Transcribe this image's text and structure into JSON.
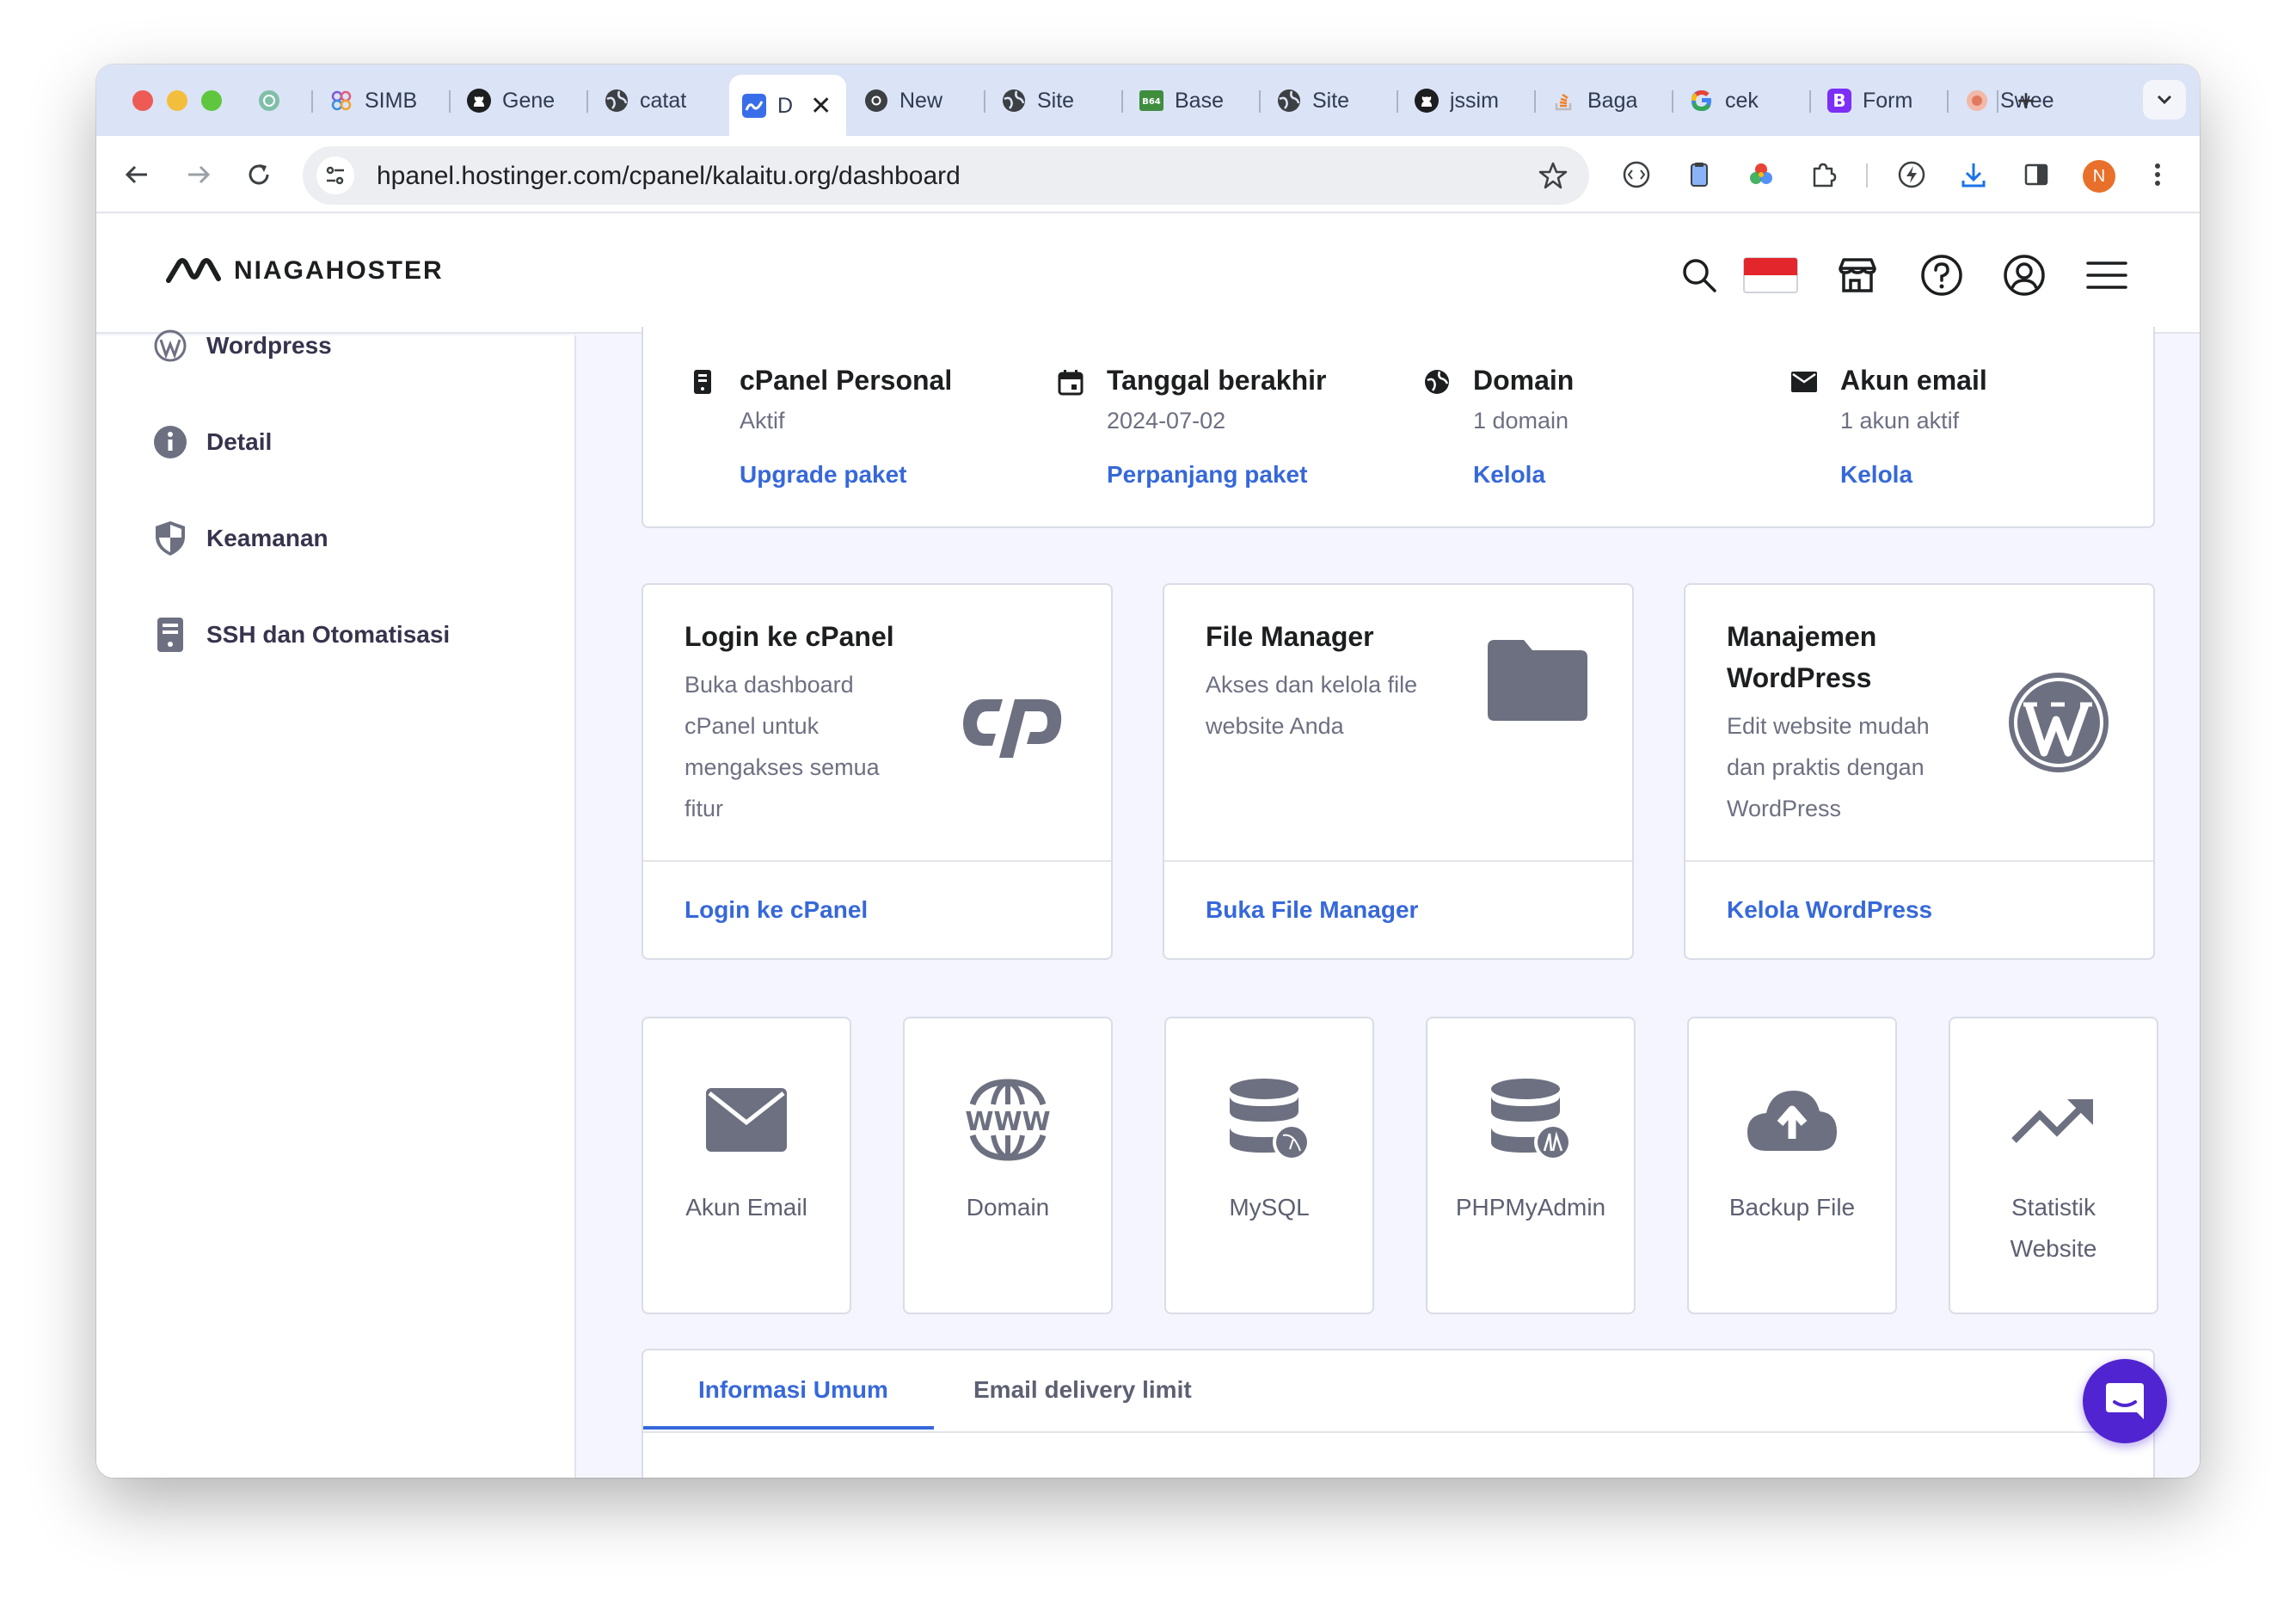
{
  "browser": {
    "tabs": [
      {
        "title": "",
        "icon": "chatgpt-icon"
      },
      {
        "title": "SIMB",
        "icon": "figma-like-icon"
      },
      {
        "title": "Gene",
        "icon": "github-icon"
      },
      {
        "title": "catat",
        "icon": "globe-icon"
      },
      {
        "title": "D",
        "icon": "hostinger-icon",
        "active": true
      },
      {
        "title": "New",
        "icon": "chrome-icon"
      },
      {
        "title": "Site",
        "icon": "globe-icon"
      },
      {
        "title": "Base",
        "icon": "b64-icon"
      },
      {
        "title": "Site",
        "icon": "globe-icon"
      },
      {
        "title": "jssim",
        "icon": "github-icon"
      },
      {
        "title": "Baga",
        "icon": "stackoverflow-icon"
      },
      {
        "title": "cek",
        "icon": "google-icon"
      },
      {
        "title": "Form",
        "icon": "bootstrap-icon"
      },
      {
        "title": "Swee",
        "icon": "sweetalert-icon"
      }
    ],
    "url_host": "hpanel.hostinger.com",
    "url_path": "/cpanel/kalaitu.org/dashboard",
    "profile_initial": "N"
  },
  "header": {
    "logo_text": "NIAGAHOSTER"
  },
  "sidebar": {
    "items": [
      {
        "label": "Wordpress",
        "icon": "wordpress-icon"
      },
      {
        "label": "Detail",
        "icon": "info-icon"
      },
      {
        "label": "Keamanan",
        "icon": "shield-icon"
      },
      {
        "label": "SSH dan Otomatisasi",
        "icon": "server-icon"
      }
    ]
  },
  "summary": [
    {
      "title": "cPanel Personal",
      "sub": "Aktif",
      "link": "Upgrade paket",
      "icon": "plan-icon"
    },
    {
      "title": "Tanggal berakhir",
      "sub": "2024-07-02",
      "link": "Perpanjang paket",
      "icon": "calendar-icon"
    },
    {
      "title": "Domain",
      "sub": "1 domain",
      "link": "Kelola",
      "icon": "globe-icon"
    },
    {
      "title": "Akun email",
      "sub": "1 akun aktif",
      "link": "Kelola",
      "icon": "mail-icon"
    }
  ],
  "features": [
    {
      "title": "Login ke cPanel",
      "desc": "Buka dashboard cPanel untuk mengakses semua fitur",
      "link": "Login ke cPanel",
      "icon": "cpanel-logo-icon"
    },
    {
      "title": "File Manager",
      "desc": "Akses dan kelola file website Anda",
      "link": "Buka File Manager",
      "icon": "folder-icon"
    },
    {
      "title": "Manajemen WordPress",
      "desc": "Edit website mudah dan praktis dengan WordPress",
      "link": "Kelola WordPress",
      "icon": "wordpress-logo-icon"
    }
  ],
  "tiles": [
    {
      "label": "Akun Email",
      "icon": "email-icon"
    },
    {
      "label": "Domain",
      "icon": "www-icon"
    },
    {
      "label": "MySQL",
      "icon": "mysql-icon"
    },
    {
      "label": "PHPMyAdmin",
      "icon": "phpmyadmin-icon"
    },
    {
      "label": "Backup File",
      "icon": "cloud-upload-icon"
    },
    {
      "label": "Statistik Website",
      "icon": "trending-up-icon"
    }
  ],
  "info_tabs": [
    {
      "label": "Informasi Umum",
      "active": true
    },
    {
      "label": "Email delivery limit",
      "active": false
    }
  ],
  "colors": {
    "accent": "#3668d9",
    "brand_purple": "#5025d1",
    "icon_gray": "#6d7081"
  }
}
